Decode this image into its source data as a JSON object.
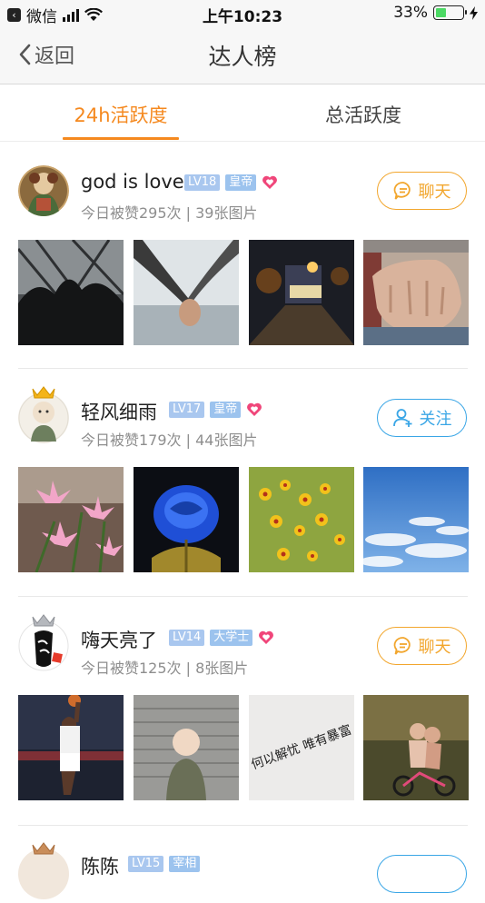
{
  "status": {
    "app": "微信",
    "time": "上午10:23",
    "battery": "33%"
  },
  "nav": {
    "back_label": "返回",
    "title": "达人榜"
  },
  "tabs": [
    {
      "label": "24h活跃度",
      "active": true
    },
    {
      "label": "总活跃度",
      "active": false
    }
  ],
  "users": [
    {
      "name": "god is love",
      "level": "LV18",
      "rank": "皇帝",
      "stats": "今日被赞295次 | 39张图片",
      "action": "聊天",
      "action_icon": "chat-bubble-icon"
    },
    {
      "name": "轻风细雨",
      "level": "LV17",
      "rank": "皇帝",
      "stats": "今日被赞179次 | 44张图片",
      "action": "关注",
      "action_icon": "add-user-icon"
    },
    {
      "name": "嗨天亮了",
      "level": "LV14",
      "rank": "大学士",
      "stats": "今日被赞125次 | 8张图片",
      "action": "聊天",
      "action_icon": "chat-bubble-icon"
    },
    {
      "name": "陈陈",
      "level": "LV15",
      "rank": "宰相",
      "stats": "",
      "action": "",
      "action_icon": "chat-bubble-icon"
    }
  ],
  "thumb_text": "何以解忧 唯有暴富",
  "colors": {
    "accent": "#f5891f",
    "chat": "#f2a62d",
    "follow": "#3aa6e6",
    "badge": "#a9c7ef"
  }
}
